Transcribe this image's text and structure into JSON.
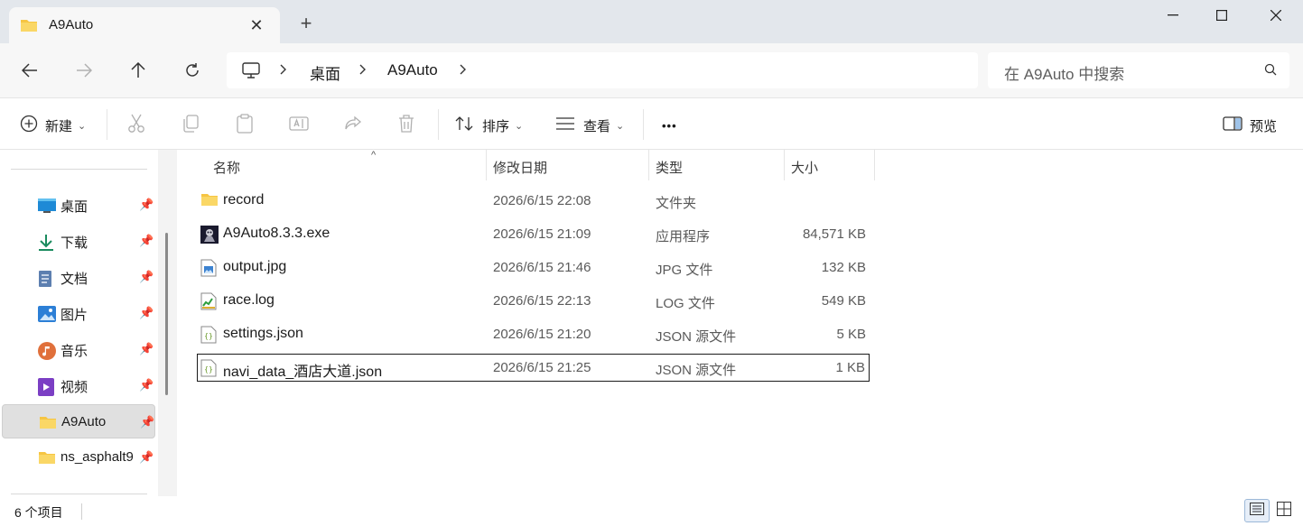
{
  "tab": {
    "title": "A9Auto",
    "close": "✕",
    "new_tab": "+"
  },
  "window": {
    "minimize": "—",
    "maximize": "☐",
    "close": "✕"
  },
  "nav": {
    "back": "←",
    "forward": "→",
    "up": "↑",
    "refresh": "↻"
  },
  "breadcrumb": {
    "items": [
      "桌面",
      "A9Auto"
    ],
    "sep": ">"
  },
  "search": {
    "placeholder": "在 A9Auto 中搜索"
  },
  "commands": {
    "new": "新建",
    "sort": "排序",
    "view": "查看",
    "more": "•••",
    "preview": "预览"
  },
  "sidebar": {
    "items": [
      {
        "label": "桌面",
        "icon": "desktop-icon"
      },
      {
        "label": "下载",
        "icon": "download-icon"
      },
      {
        "label": "文档",
        "icon": "document-icon"
      },
      {
        "label": "图片",
        "icon": "pictures-icon"
      },
      {
        "label": "音乐",
        "icon": "music-icon"
      },
      {
        "label": "视频",
        "icon": "video-icon"
      },
      {
        "label": "A9Auto",
        "icon": "folder-icon",
        "selected": true
      },
      {
        "label": "ns_asphalt9",
        "icon": "folder-icon"
      }
    ]
  },
  "columns": {
    "name": "名称",
    "date": "修改日期",
    "type": "类型",
    "size": "大小"
  },
  "files": [
    {
      "name": "record",
      "date": "2026/6/15 22:08",
      "type": "文件夹",
      "size": "",
      "icon": "folder-icon"
    },
    {
      "name": "A9Auto8.3.3.exe",
      "date": "2026/6/15 21:09",
      "type": "应用程序",
      "size": "84,571 KB",
      "icon": "exe-icon"
    },
    {
      "name": "output.jpg",
      "date": "2026/6/15 21:46",
      "type": "JPG 文件",
      "size": "132 KB",
      "icon": "image-file-icon"
    },
    {
      "name": "race.log",
      "date": "2026/6/15 22:13",
      "type": "LOG 文件",
      "size": "549 KB",
      "icon": "log-file-icon"
    },
    {
      "name": "settings.json",
      "date": "2026/6/15 21:20",
      "type": "JSON 源文件",
      "size": "5 KB",
      "icon": "json-file-icon"
    },
    {
      "name": "navi_data_酒店大道.json",
      "date": "2026/6/15 21:25",
      "type": "JSON 源文件",
      "size": "1 KB",
      "icon": "json-file-icon"
    }
  ],
  "status": {
    "count": "6 个项目"
  },
  "colors": {
    "titlebar": "#e3e7ec",
    "folder": "#f6c543",
    "accent": "#0067c0"
  }
}
